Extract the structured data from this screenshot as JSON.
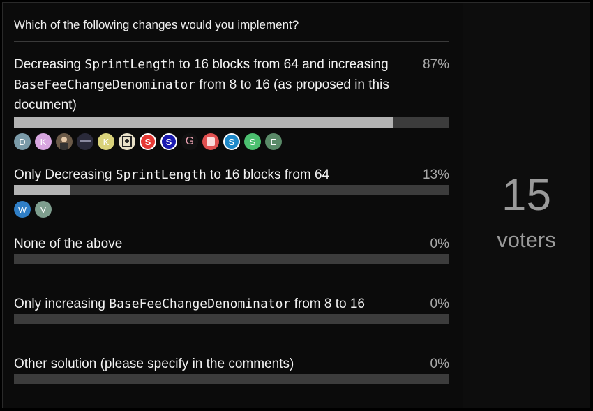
{
  "question": "Which of the following changes would you implement?",
  "options": [
    {
      "parts": [
        "Decreasing ",
        "SprintLength",
        " to 16 blocks from 64 and increasing ",
        "BaseFeeChangeDenominator",
        " from 8 to 16 (as proposed in this document)"
      ],
      "percent_label": "87%",
      "percent": 87,
      "voters": [
        {
          "letter": "D",
          "color": "#7a9aa8",
          "icon": "avatar-letter"
        },
        {
          "letter": "K",
          "color": "#d8a6e0",
          "icon": "avatar-letter"
        },
        {
          "letter": "",
          "color": "#6b5a48",
          "icon": "person-photo-icon"
        },
        {
          "letter": "",
          "color": "#2a2a3a",
          "icon": "logo-icon"
        },
        {
          "letter": "K",
          "color": "#d9d27a",
          "icon": "avatar-letter"
        },
        {
          "letter": "",
          "color": "#e8e0c8",
          "icon": "badge-icon"
        },
        {
          "letter": "S",
          "color": "#e53935",
          "icon": "s-logo-icon"
        },
        {
          "letter": "S",
          "color": "#1a1ab0",
          "icon": "s-logo-icon"
        },
        {
          "letter": "G",
          "color": "#111111",
          "icon": "g-logo-icon"
        },
        {
          "letter": "",
          "color": "#e05050",
          "icon": "app-icon"
        },
        {
          "letter": "S",
          "color": "#1e88c8",
          "icon": "s-logo-icon"
        },
        {
          "letter": "S",
          "color": "#4cc070",
          "icon": "avatar-letter"
        },
        {
          "letter": "E",
          "color": "#5a8a68",
          "icon": "avatar-letter"
        }
      ]
    },
    {
      "parts": [
        "Only Decreasing ",
        "SprintLength",
        " to 16 blocks from 64",
        "",
        ""
      ],
      "percent_label": "13%",
      "percent": 13,
      "voters": [
        {
          "letter": "W",
          "color": "#2f7ec6",
          "icon": "avatar-letter"
        },
        {
          "letter": "V",
          "color": "#7e9e8e",
          "icon": "avatar-letter"
        }
      ]
    },
    {
      "parts": [
        "None of the above",
        "",
        "",
        "",
        ""
      ],
      "percent_label": "0%",
      "percent": 0,
      "voters": []
    },
    {
      "parts": [
        "Only increasing ",
        "BaseFeeChangeDenominator",
        " from 8 to 16",
        "",
        ""
      ],
      "percent_label": "0%",
      "percent": 0,
      "voters": []
    },
    {
      "parts": [
        "Other solution (please specify in the comments)",
        "",
        "",
        "",
        ""
      ],
      "percent_label": "0%",
      "percent": 0,
      "voters": []
    }
  ],
  "summary": {
    "count": "15",
    "label": "voters"
  },
  "colors": {
    "bar_fill": "#b3b3b3",
    "bar_track": "#3c3c3c",
    "background": "#0b0b0b"
  }
}
